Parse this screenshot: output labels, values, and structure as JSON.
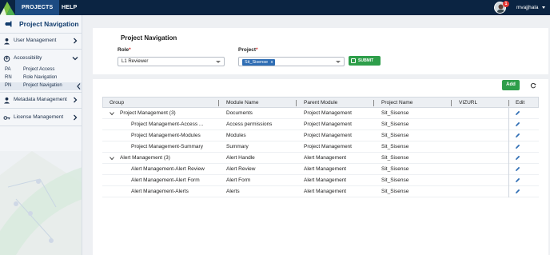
{
  "topbar": {
    "tabs": [
      {
        "label": "PROJECTS",
        "active": true
      },
      {
        "label": "HELP",
        "active": false
      }
    ],
    "notification_count": "1",
    "username": "mvajjhala",
    "bg_color": "#0b2442",
    "active_tab_color": "#1d4b82"
  },
  "sidebar": {
    "title": "Project Navigation",
    "items": [
      {
        "label": "User Management",
        "icon": "user-icon",
        "expanded": false
      },
      {
        "label": "Accessibility",
        "icon": "accessibility-icon",
        "expanded": true
      },
      {
        "label": "Metadata Management",
        "icon": "user-icon",
        "expanded": false
      },
      {
        "label": "License Management",
        "icon": "key-icon",
        "expanded": false
      }
    ],
    "sub_items": [
      {
        "abbr": "PA",
        "label": "Project Access"
      },
      {
        "abbr": "RN",
        "label": "Role Navigation"
      },
      {
        "abbr": "PN",
        "label": "Project Navigation",
        "active": true
      }
    ]
  },
  "filters": {
    "title": "Project Navigation",
    "role_label": "Role",
    "role_value": "L1 Reviewer",
    "project_label": "Project",
    "project_chip": "Sit_Sisense",
    "chip_remove": "x",
    "required_mark": "*",
    "submit_label": "SUBMIT"
  },
  "toolbar": {
    "add_label": "Add"
  },
  "table": {
    "columns": [
      "Group",
      "Module Name",
      "Parent Module",
      "Project Name",
      "VIZURL",
      "Edit"
    ],
    "groups": [
      {
        "label": "Project Management (3)",
        "module": "Documents",
        "parent": "Project Management",
        "project": "Sit_Sisense",
        "vizurl": "",
        "children": [
          {
            "group": "Project Management-Access ...",
            "module": "Access permissions",
            "parent": "Project Management",
            "project": "Sit_Sisense",
            "vizurl": ""
          },
          {
            "group": "Project Management-Modules",
            "module": "Modules",
            "parent": "Project Management",
            "project": "Sit_Sisense",
            "vizurl": ""
          },
          {
            "group": "Project Management-Summary",
            "module": "Summary",
            "parent": "Project Management",
            "project": "Sit_Sisense",
            "vizurl": ""
          }
        ]
      },
      {
        "label": "Alert Management (3)",
        "module": "Alert Handle",
        "parent": "Alert Management",
        "project": "Sit_Sisense",
        "vizurl": "",
        "children": [
          {
            "group": "Alert Management-Alert Review",
            "module": "Alert Review",
            "parent": "Alert Management",
            "project": "Sit_Sisense",
            "vizurl": ""
          },
          {
            "group": "Alert Management-Alert Form",
            "module": "Alert Form",
            "parent": "Alert Management",
            "project": "Sit_Sisense",
            "vizurl": ""
          },
          {
            "group": "Alert Management-Alerts",
            "module": "Alerts",
            "parent": "Alert Management",
            "project": "Sit_Sisense",
            "vizurl": ""
          }
        ]
      }
    ]
  },
  "colors": {
    "accent_green": "#2e9e4a",
    "chip_blue": "#2e6db4",
    "edit_icon_blue": "#2e6db4",
    "required_red": "#d32f2f"
  }
}
